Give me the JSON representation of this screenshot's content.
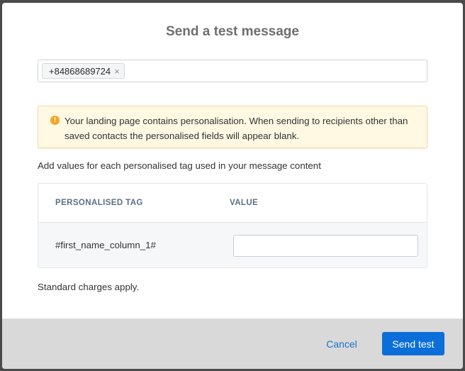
{
  "dialog": {
    "title": "Send a test message"
  },
  "recipients": {
    "chips": [
      {
        "label": "+84868689724",
        "remove_glyph": "×"
      }
    ]
  },
  "alert": {
    "icon": "warning-icon",
    "icon_glyph": "!",
    "color": "#f5a623",
    "message": "Your landing page contains personalisation. When sending to recipients other than saved contacts the personalised fields will appear blank."
  },
  "personalisation": {
    "helper": "Add values for each personalised tag used in your message content",
    "columns": {
      "tag": "PERSONALISED TAG",
      "value": "VALUE"
    },
    "rows": [
      {
        "tag": "#first_name_column_1#",
        "value": ""
      }
    ]
  },
  "charges_note": "Standard charges apply.",
  "footer": {
    "cancel_label": "Cancel",
    "send_label": "Send test",
    "primary_color": "#0a6fd8"
  }
}
